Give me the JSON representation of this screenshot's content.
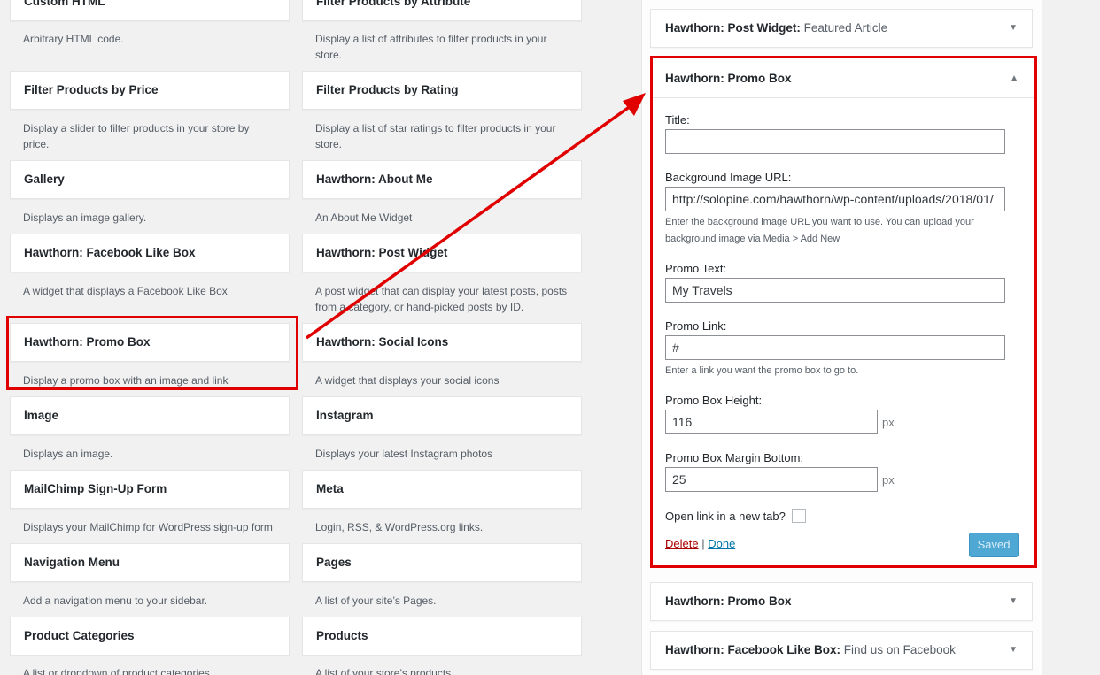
{
  "widgets_left": [
    {
      "title": "Custom HTML",
      "desc": "Arbitrary HTML code."
    },
    {
      "title": "Filter Products by Price",
      "desc": "Display a slider to filter products in your store by price."
    },
    {
      "title": "Gallery",
      "desc": "Displays an image gallery."
    },
    {
      "title": "Hawthorn: Facebook Like Box",
      "desc": "A widget that displays a Facebook Like Box"
    },
    {
      "title": "Hawthorn: Promo Box",
      "desc": "Display a promo box with an image and link"
    },
    {
      "title": "Image",
      "desc": "Displays an image."
    },
    {
      "title": "MailChimp Sign-Up Form",
      "desc": "Displays your MailChimp for WordPress sign-up form"
    },
    {
      "title": "Navigation Menu",
      "desc": "Add a navigation menu to your sidebar."
    },
    {
      "title": "Product Categories",
      "desc": "A list or dropdown of product categories."
    }
  ],
  "widgets_right": [
    {
      "title": "Filter Products by Attribute",
      "desc": "Display a list of attributes to filter products in your store."
    },
    {
      "title": "Filter Products by Rating",
      "desc": "Display a list of star ratings to filter products in your store."
    },
    {
      "title": "Hawthorn: About Me",
      "desc": "An About Me Widget"
    },
    {
      "title": "Hawthorn: Post Widget",
      "desc": "A post widget that can display your latest posts, posts from a category, or hand-picked posts by ID."
    },
    {
      "title": "Hawthorn: Social Icons",
      "desc": "A widget that displays your social icons"
    },
    {
      "title": "Instagram",
      "desc": "Displays your latest Instagram photos"
    },
    {
      "title": "Meta",
      "desc": "Login, RSS, & WordPress.org links."
    },
    {
      "title": "Pages",
      "desc": "A list of your site’s Pages."
    },
    {
      "title": "Products",
      "desc": "A list of your store’s products."
    }
  ],
  "sidebar": {
    "top_widget": {
      "title": "Hawthorn: Post Widget:",
      "subtitle": "Featured Article"
    },
    "expanded": {
      "title": "Hawthorn: Promo Box",
      "title_label": "Title:",
      "title_value": "",
      "bg_label": "Background Image URL:",
      "bg_value": "http://solopine.com/hawthorn/wp-content/uploads/2018/01/",
      "bg_help": "Enter the background image URL you want to use. You can upload your background image via Media > Add New",
      "promo_text_label": "Promo Text:",
      "promo_text_value": "My Travels",
      "promo_link_label": "Promo Link:",
      "promo_link_value": "#",
      "promo_link_help": "Enter a link you want the promo box to go to.",
      "height_label": "Promo Box Height:",
      "height_value": "116",
      "margin_label": "Promo Box Margin Bottom:",
      "margin_value": "25",
      "unit": "px",
      "newtab_label": "Open link in a new tab?",
      "newtab_checked": false,
      "delete_label": "Delete",
      "separator": "|",
      "done_label": "Done",
      "saved_label": "Saved"
    },
    "bottom_widgets": [
      {
        "title": "Hawthorn: Promo Box",
        "subtitle": ""
      },
      {
        "title": "Hawthorn: Facebook Like Box:",
        "subtitle": "Find us on Facebook"
      }
    ]
  },
  "icons": {
    "toggle_collapsed": "triangle-down",
    "toggle_expanded": "triangle-up"
  },
  "colors": {
    "highlight": "#e00000",
    "saved_button": "#4fa8d4",
    "delete_link": "#aa0000",
    "done_link": "#0073aa"
  }
}
